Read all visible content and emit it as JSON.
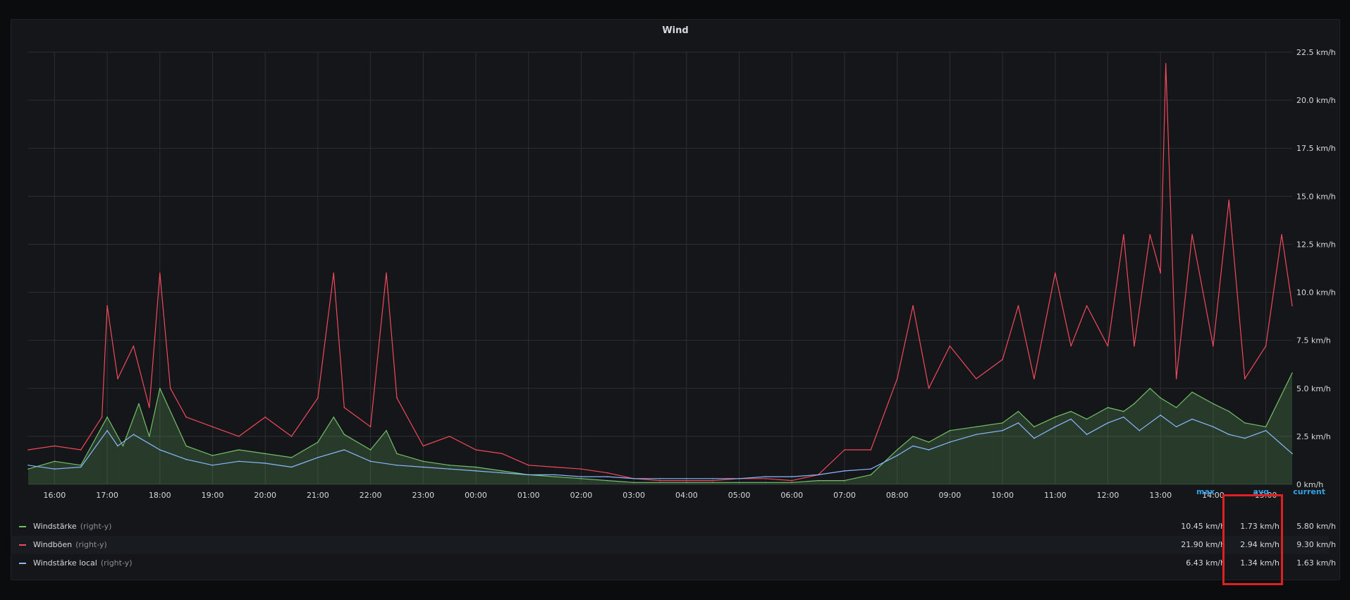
{
  "panel": {
    "title": "Wind"
  },
  "legend": {
    "headers": {
      "max": "max",
      "avg": "avg",
      "current": "current"
    },
    "rows": [
      {
        "name": "Windstärke",
        "axis": "(right-y)",
        "color": "#73bf69",
        "max": "10.45 km/h",
        "avg": "1.73 km/h",
        "current": "5.80 km/h"
      },
      {
        "name": "Windböen",
        "axis": "(right-y)",
        "color": "#f2495c",
        "max": "21.90 km/h",
        "avg": "2.94 km/h",
        "current": "9.30 km/h"
      },
      {
        "name": "Windstärke local",
        "axis": "(right-y)",
        "color": "#8ab8ff",
        "max": "6.43 km/h",
        "avg": "1.34 km/h",
        "current": "1.63 km/h"
      }
    ]
  },
  "chart_data": {
    "type": "line",
    "title": "Wind",
    "y_axis": "right",
    "ylim": [
      0,
      22.5
    ],
    "yticks": [
      "0 km/h",
      "2.5 km/h",
      "5.0 km/h",
      "7.5 km/h",
      "10.0 km/h",
      "12.5 km/h",
      "15.0 km/h",
      "17.5 km/h",
      "20.0 km/h",
      "22.5 km/h"
    ],
    "ytick_values": [
      0,
      2.5,
      5,
      7.5,
      10,
      12.5,
      15,
      17.5,
      20,
      22.5
    ],
    "x_hours_range": [
      15.5,
      39.5
    ],
    "xticks": [
      "16:00",
      "17:00",
      "18:00",
      "19:00",
      "20:00",
      "21:00",
      "22:00",
      "23:00",
      "00:00",
      "01:00",
      "02:00",
      "03:00",
      "04:00",
      "05:00",
      "06:00",
      "07:00",
      "08:00",
      "09:00",
      "10:00",
      "11:00",
      "12:00",
      "13:00",
      "14:00",
      "15:00"
    ],
    "xtick_hours": [
      16,
      17,
      18,
      19,
      20,
      21,
      22,
      23,
      24,
      25,
      26,
      27,
      28,
      29,
      30,
      31,
      32,
      33,
      34,
      35,
      36,
      37,
      38,
      39
    ],
    "grid": true,
    "series": [
      {
        "name": "Windstärke",
        "color": "#73bf69",
        "fill": true,
        "x": [
          15.5,
          16.0,
          16.5,
          17.0,
          17.3,
          17.6,
          17.8,
          18.0,
          18.5,
          19.0,
          19.5,
          20.0,
          20.5,
          21.0,
          21.3,
          21.5,
          22.0,
          22.3,
          22.5,
          23.0,
          23.5,
          24.0,
          24.5,
          25.0,
          25.5,
          26.0,
          26.5,
          27.0,
          27.5,
          28.0,
          28.5,
          29.0,
          29.5,
          30.0,
          30.5,
          31.0,
          31.5,
          32.0,
          32.3,
          32.6,
          33.0,
          33.5,
          34.0,
          34.3,
          34.6,
          35.0,
          35.3,
          35.6,
          36.0,
          36.3,
          36.5,
          36.8,
          37.0,
          37.3,
          37.6,
          38.0,
          38.3,
          38.6,
          39.0,
          39.5
        ],
        "y": [
          0.8,
          1.2,
          1.0,
          3.5,
          2.0,
          4.2,
          2.5,
          5.0,
          2.0,
          1.5,
          1.8,
          1.6,
          1.4,
          2.2,
          3.5,
          2.6,
          1.8,
          2.8,
          1.6,
          1.2,
          1.0,
          0.9,
          0.7,
          0.5,
          0.4,
          0.3,
          0.2,
          0.1,
          0.1,
          0.1,
          0.1,
          0.1,
          0.1,
          0.1,
          0.2,
          0.2,
          0.5,
          1.8,
          2.5,
          2.2,
          2.8,
          3.0,
          3.2,
          3.8,
          3.0,
          3.5,
          3.8,
          3.4,
          4.0,
          3.8,
          4.2,
          5.0,
          4.5,
          4.0,
          4.8,
          4.2,
          3.8,
          3.2,
          3.0,
          5.8
        ]
      },
      {
        "name": "Windböen",
        "color": "#f2495c",
        "fill": false,
        "x": [
          15.5,
          16.0,
          16.5,
          16.9,
          17.0,
          17.2,
          17.5,
          17.8,
          18.0,
          18.2,
          18.5,
          19.0,
          19.5,
          20.0,
          20.5,
          21.0,
          21.3,
          21.5,
          22.0,
          22.3,
          22.5,
          23.0,
          23.5,
          24.0,
          24.5,
          25.0,
          25.5,
          26.0,
          26.5,
          27.0,
          27.5,
          28.0,
          28.5,
          29.0,
          29.5,
          30.0,
          30.5,
          31.0,
          31.5,
          32.0,
          32.3,
          32.6,
          33.0,
          33.5,
          34.0,
          34.3,
          34.6,
          35.0,
          35.3,
          35.6,
          36.0,
          36.3,
          36.5,
          36.8,
          37.0,
          37.1,
          37.3,
          37.6,
          38.0,
          38.3,
          38.6,
          39.0,
          39.3,
          39.5
        ],
        "y": [
          1.8,
          2.0,
          1.8,
          3.5,
          9.3,
          5.5,
          7.2,
          4.0,
          11.0,
          5.0,
          3.5,
          3.0,
          2.5,
          3.5,
          2.5,
          4.5,
          11.0,
          4.0,
          3.0,
          11.0,
          4.5,
          2.0,
          2.5,
          1.8,
          1.6,
          1.0,
          0.9,
          0.8,
          0.6,
          0.3,
          0.2,
          0.2,
          0.2,
          0.3,
          0.3,
          0.2,
          0.5,
          1.8,
          1.8,
          5.5,
          9.3,
          5.0,
          7.2,
          5.5,
          6.5,
          9.3,
          5.5,
          11.0,
          7.2,
          9.3,
          7.2,
          13.0,
          7.2,
          13.0,
          11.0,
          21.9,
          5.5,
          13.0,
          7.2,
          14.8,
          5.5,
          7.2,
          13.0,
          9.3
        ]
      },
      {
        "name": "Windstärke local",
        "color": "#8ab8ff",
        "fill": false,
        "x": [
          15.5,
          16.0,
          16.5,
          17.0,
          17.2,
          17.5,
          18.0,
          18.5,
          19.0,
          19.5,
          20.0,
          20.5,
          21.0,
          21.5,
          22.0,
          22.5,
          23.0,
          23.5,
          24.0,
          24.5,
          25.0,
          25.5,
          26.0,
          26.5,
          27.0,
          27.5,
          28.0,
          28.5,
          29.0,
          29.5,
          30.0,
          30.5,
          31.0,
          31.5,
          32.0,
          32.3,
          32.6,
          33.0,
          33.5,
          34.0,
          34.3,
          34.6,
          35.0,
          35.3,
          35.6,
          36.0,
          36.3,
          36.6,
          37.0,
          37.3,
          37.6,
          38.0,
          38.3,
          38.6,
          39.0,
          39.5
        ],
        "y": [
          1.0,
          0.8,
          0.9,
          2.8,
          2.0,
          2.6,
          1.8,
          1.3,
          1.0,
          1.2,
          1.1,
          0.9,
          1.4,
          1.8,
          1.2,
          1.0,
          0.9,
          0.8,
          0.7,
          0.6,
          0.5,
          0.5,
          0.4,
          0.4,
          0.3,
          0.3,
          0.3,
          0.3,
          0.3,
          0.4,
          0.4,
          0.5,
          0.7,
          0.8,
          1.5,
          2.0,
          1.8,
          2.2,
          2.6,
          2.8,
          3.2,
          2.4,
          3.0,
          3.4,
          2.6,
          3.2,
          3.5,
          2.8,
          3.6,
          3.0,
          3.4,
          3.0,
          2.6,
          2.4,
          2.8,
          1.6
        ]
      }
    ]
  }
}
